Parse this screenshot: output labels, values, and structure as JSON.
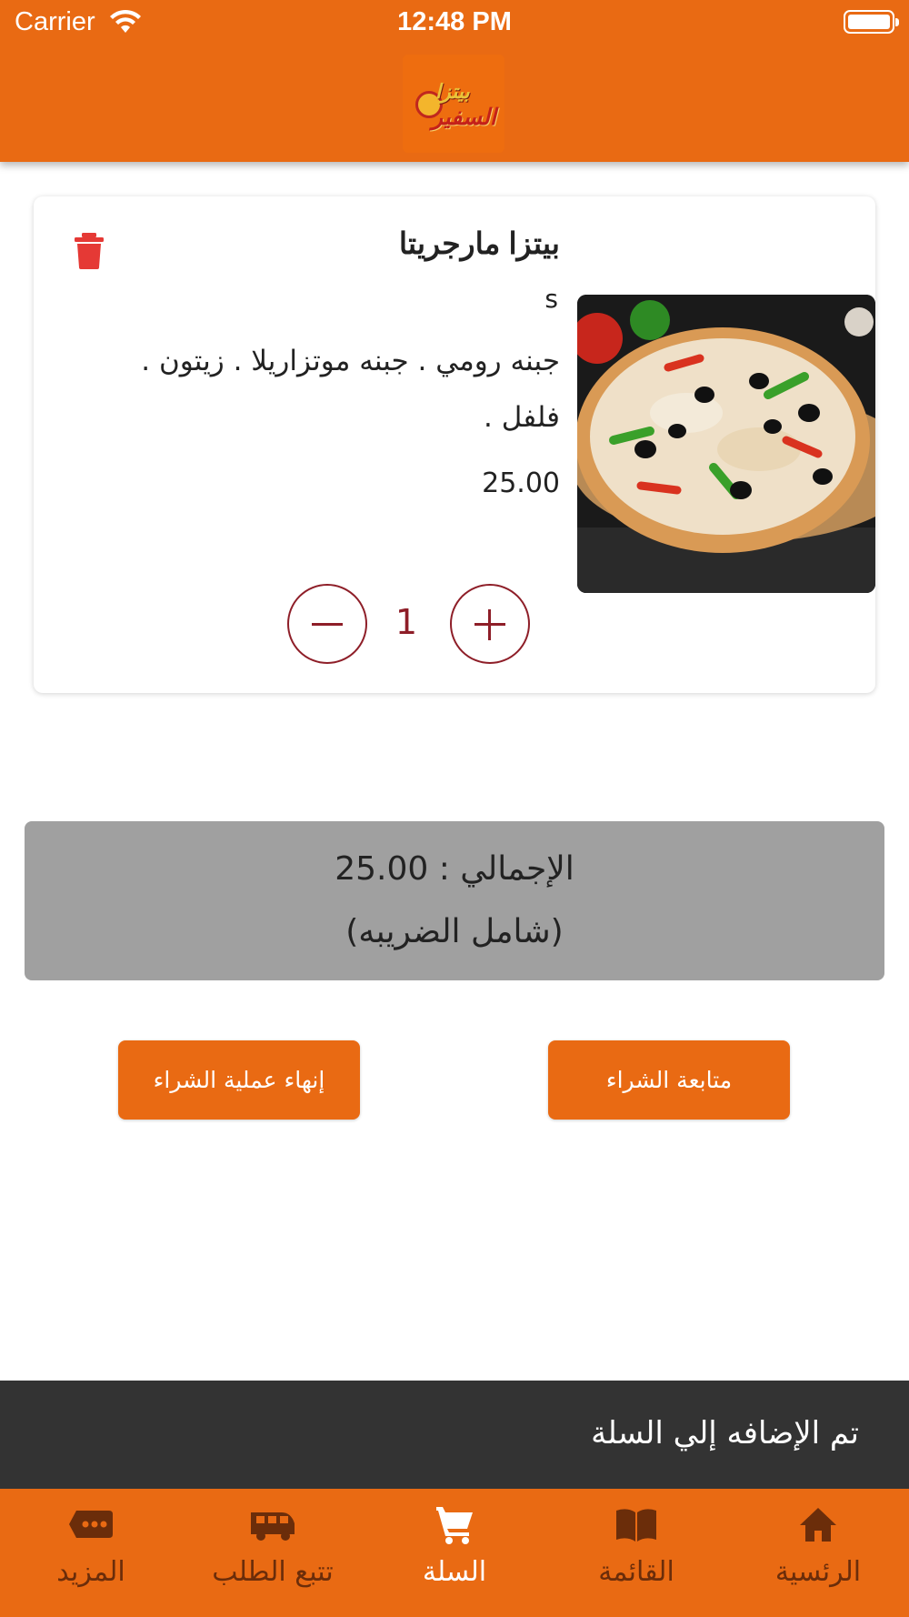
{
  "status_bar": {
    "carrier": "Carrier",
    "time": "12:48 PM"
  },
  "header": {
    "logo_top": "بيتزا",
    "logo_bottom": "السفير"
  },
  "cart_item": {
    "name": "بيتزا مارجريتا",
    "size": "s",
    "description": "جبنه رومي . جبنه موتزاريلا . زيتون . فلفل .",
    "price": "25.00",
    "quantity": "1"
  },
  "total": {
    "label": "الإجمالي : 25.00",
    "tax_note": "(شامل الضريبه)"
  },
  "actions": {
    "finish_label": "إنهاء عملية الشراء",
    "continue_label": "متابعة الشراء"
  },
  "toast": {
    "message": "تم الإضافه إلي السلة"
  },
  "tabs": [
    {
      "label": "الرئسية",
      "icon": "home-icon"
    },
    {
      "label": "القائمة",
      "icon": "menu-book-icon"
    },
    {
      "label": "السلة",
      "icon": "cart-icon",
      "active": true
    },
    {
      "label": "تتبع الطلب",
      "icon": "truck-icon"
    },
    {
      "label": "المزيد",
      "icon": "more-icon"
    }
  ],
  "colors": {
    "brand_orange": "#e96a13",
    "accent_maroon": "#8e1e28",
    "delete_red": "#e53935",
    "toast_bg": "#333333",
    "total_bg": "#a0a0a0"
  }
}
